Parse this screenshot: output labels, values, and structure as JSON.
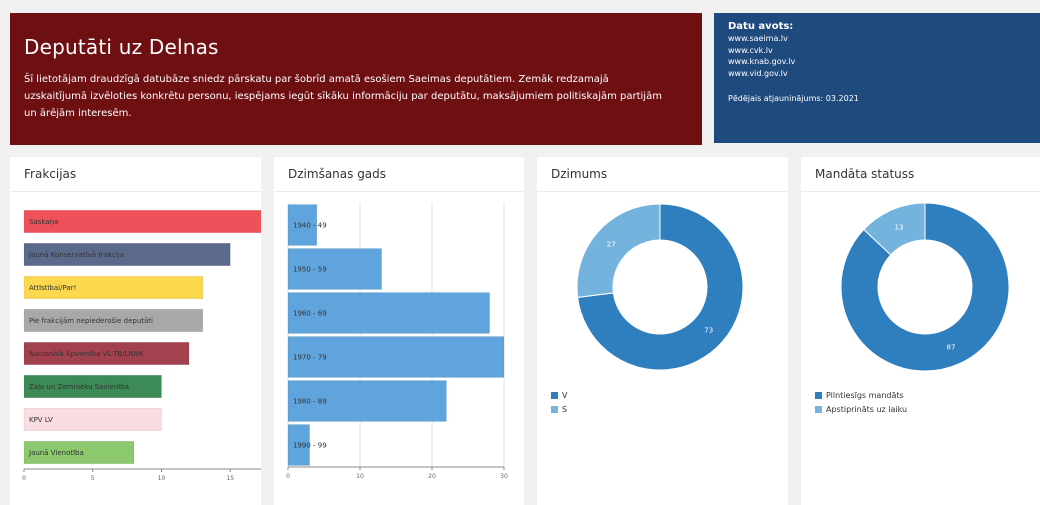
{
  "header": {
    "title": "Deputāti uz Delnas",
    "description": "Šī lietotājam draudzīgā datubāze sniedz pārskatu par šobrīd amatā esošiem Saeimas deputātiem. Zemāk redzamajā uzskaitījumā izvēloties konkrētu personu, iespējams iegūt sīkāku informāciju par deputātu, maksājumiem politiskajām partijām un ārējām interesēm."
  },
  "source": {
    "title": "Datu avots:",
    "links": [
      "www.saeima.lv",
      "www.cvk.lv",
      "www.knab.gov.lv",
      "www.vid.gov.lv"
    ],
    "updated": "Pēdējais atjauninājums: 03.2021"
  },
  "cards": {
    "fractions": "Frakcijas",
    "birth": "Dzimšanas gads",
    "gender": "Dzimums",
    "mandate": "Mandāta statuss"
  },
  "chart_data": [
    {
      "type": "bar",
      "orientation": "horizontal",
      "title": "Frakcijas",
      "categories": [
        "Saskaņa",
        "Jaunā Konservatīvā frakcija",
        "Attīstībai/Par!",
        "Pie frakcijām nepiederošie deputāti",
        "Nacionālā Apvienība VL-TB/LNNK",
        "Zaļo un Zemnieku Savienība",
        "KPV LV",
        "Jaunā Vienotība"
      ],
      "values": [
        19,
        15,
        13,
        13,
        12,
        10,
        10,
        8
      ],
      "colors": [
        "#f0505a",
        "#5b6a8c",
        "#fbd84e",
        "#a8a8a8",
        "#a3424e",
        "#3c8a55",
        "#fadde1",
        "#8cc96e"
      ],
      "xticks": [
        0,
        5,
        10,
        15
      ],
      "xlim": [
        0,
        20
      ]
    },
    {
      "type": "bar",
      "orientation": "horizontal",
      "title": "Dzimšanas gads",
      "categories": [
        "1940 - 49",
        "1950 - 59",
        "1960 - 69",
        "1970 - 79",
        "1980 - 89",
        "1990 - 99"
      ],
      "values": [
        4,
        13,
        28,
        30,
        22,
        3
      ],
      "color": "#5fa4dc",
      "xticks": [
        0,
        10,
        20,
        30
      ],
      "xlim": [
        0,
        30
      ]
    },
    {
      "type": "pie",
      "title": "Dzimums",
      "labels": [
        "V",
        "S"
      ],
      "values": [
        73,
        27
      ],
      "colors": [
        "#2f7ebd",
        "#74b3dd"
      ]
    },
    {
      "type": "pie",
      "title": "Mandāta statuss",
      "labels": [
        "Pilntiesīgs mandāts",
        "Apstiprināts uz laiku"
      ],
      "values": [
        87,
        13
      ],
      "colors": [
        "#2f7ebd",
        "#74b3dd"
      ]
    }
  ]
}
